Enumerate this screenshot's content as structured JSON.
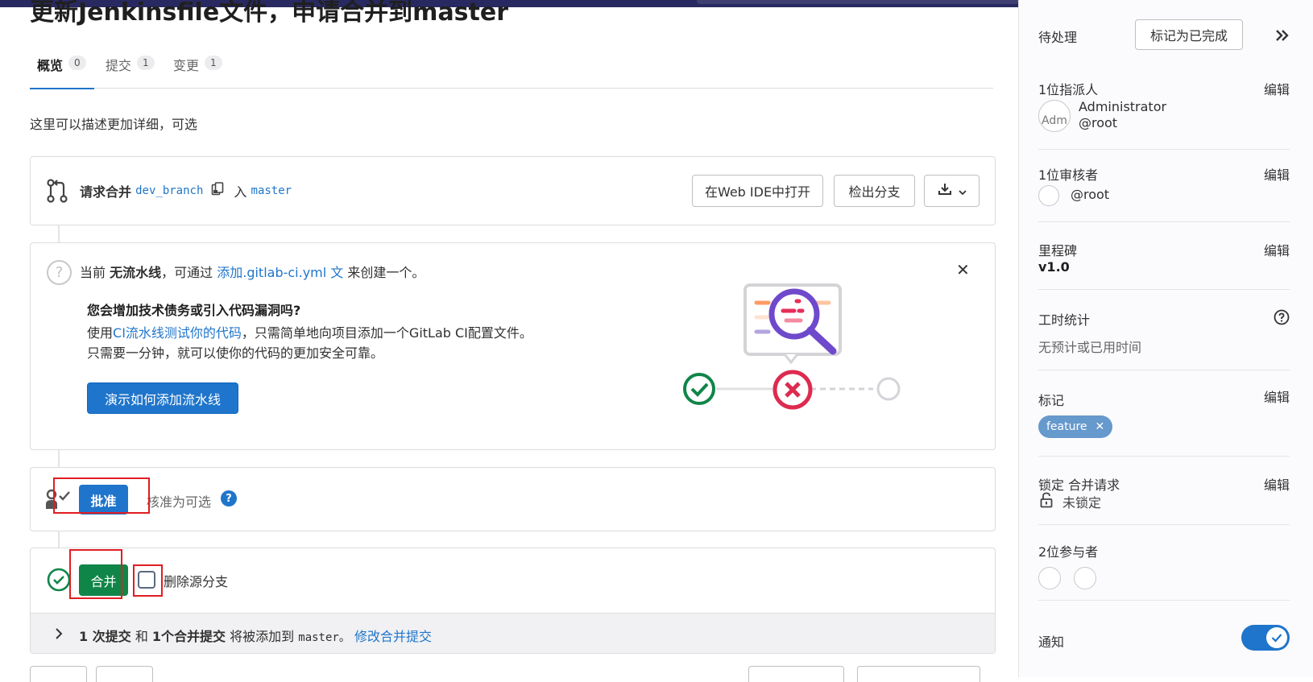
{
  "page_title": "更新Jenkinsfile文件，申请合并到master",
  "tabs": [
    {
      "label": "概览",
      "count": "0"
    },
    {
      "label": "提交",
      "count": "1"
    },
    {
      "label": "变更",
      "count": "1"
    }
  ],
  "description": "这里可以描述更加详细，可选",
  "merge_request": {
    "label": "请求合并",
    "source_branch": "dev_branch",
    "into": "入",
    "target_branch": "master",
    "open_web_ide": "在Web IDE中打开",
    "checkout_branch": "检出分支"
  },
  "pipeline": {
    "prefix": "当前",
    "no_pipeline": "无流水线",
    "middle": "，可通过",
    "add_link": "添加.gitlab-ci.yml 文",
    "suffix": "来创建一个。",
    "heading": "您会增加技术债务或引入代码漏洞吗?",
    "body1_pre": "使用",
    "body1_link": "CI流水线测试你的代码",
    "body1_post": "，只需简单地向项目添加一个GitLab CI配置文件。",
    "body2": "只需要一分钟，就可以使你的代码的更加安全可靠。",
    "cta": "演示如何添加流水线"
  },
  "approval": {
    "button": "批准",
    "optional_text": "核准为可选"
  },
  "merge": {
    "button": "合并",
    "delete_source": "删除源分支",
    "footer_commits": "1 次提交",
    "footer_and": "和",
    "footer_merge_commit": "1个合并提交",
    "footer_will_add": "将被添加到",
    "footer_target": "master。",
    "footer_modify": "修改合并提交"
  },
  "sidebar": {
    "todo_label": "待处理",
    "mark_done": "标记为已完成",
    "assignees_title": "1位指派人",
    "edit": "编辑",
    "assignee_name": "Administrator",
    "assignee_handle": "@root",
    "assignee_avatar_alt": "Adm",
    "reviewers_title": "1位审核者",
    "reviewer_handle": "@root",
    "milestone_title": "里程碑",
    "milestone_value": "v1.0",
    "time_title": "工时统计",
    "time_value": "无预计或已用时间",
    "labels_title": "标记",
    "label_name": "feature",
    "lock_title": "锁定 合并请求",
    "lock_value": "未锁定",
    "participants_title": "2位参与者",
    "notifications_title": "通知"
  },
  "colors": {
    "primary": "#1f75cb",
    "merge_green": "#108548",
    "danger_red": "#dd2b0e",
    "highlight": "#e11d21"
  }
}
